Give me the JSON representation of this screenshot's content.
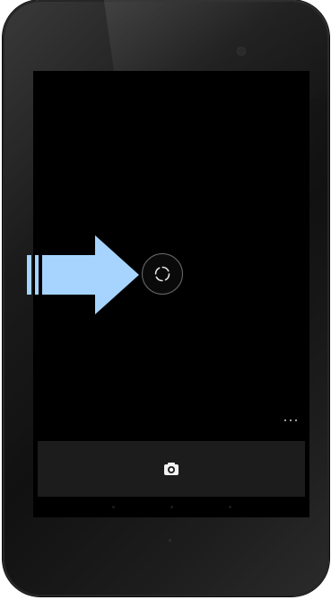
{
  "device": {
    "frame_color": "#151515",
    "screen_color": "#000000"
  },
  "camera_app": {
    "viewfinder_state": "blank",
    "shutter_indicator_icon": "loading-ring-icon",
    "overflow_menu_icon": "more-horizontal-icon",
    "mode_button_icon": "camera-icon",
    "bottom_bar_color": "#1c1c1c"
  },
  "annotation": {
    "arrow_icon": "right-arrow-pointer-icon",
    "arrow_color": "#a6d4ff",
    "points_to": "shutter_indicator"
  }
}
